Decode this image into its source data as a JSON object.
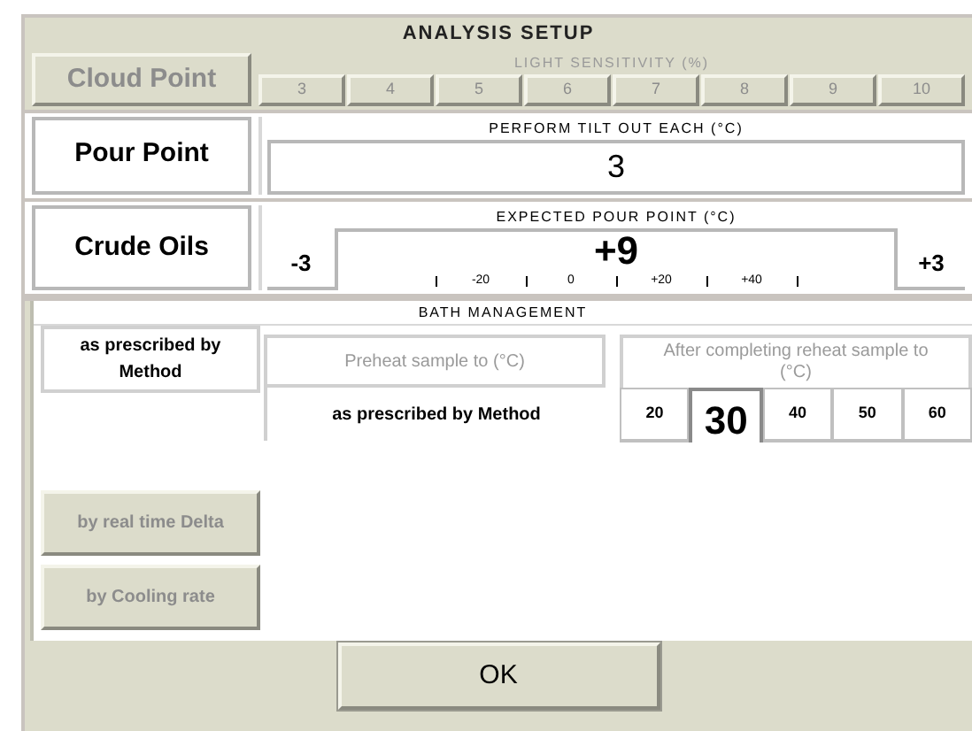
{
  "window": {
    "title": "ANALYSIS SETUP"
  },
  "cloud_point": {
    "label": "Cloud Point",
    "selected": false
  },
  "light_sensitivity": {
    "label": "LIGHT SENSITIVITY (%)",
    "disabled": true,
    "options": [
      {
        "label": "3"
      },
      {
        "label": "4"
      },
      {
        "label": "5"
      },
      {
        "label": "6"
      },
      {
        "label": "7"
      },
      {
        "label": "8"
      },
      {
        "label": "9"
      },
      {
        "label": "10"
      }
    ]
  },
  "pour_point": {
    "label": "Pour Point",
    "selected": true
  },
  "tilt_out": {
    "label": "PERFORM TILT OUT EACH (°C)",
    "value": "3"
  },
  "oil_type": {
    "label": "Crude Oils",
    "selected": true
  },
  "expected_pour_point": {
    "label": "EXPECTED POUR POINT (°C)",
    "decrement": "-3",
    "value": "+9",
    "increment": "+3",
    "scale_labels": [
      "-20",
      "0",
      "+20",
      "+40"
    ]
  },
  "bath_management": {
    "title": "BATH MANAGEMENT",
    "methods": [
      {
        "label": "as prescribed by Method",
        "selected": true
      },
      {
        "label": "by real time Delta",
        "selected": false
      },
      {
        "label": "by Cooling rate",
        "selected": false
      }
    ],
    "preheat": {
      "label": "Preheat sample to (°C)",
      "disabled": true,
      "value": "as prescribed by Method"
    },
    "reheat": {
      "label": "After completing reheat sample to (°C)",
      "disabled": true,
      "options": [
        {
          "label": "20",
          "selected": false
        },
        {
          "label": "30",
          "selected": true
        },
        {
          "label": "40",
          "selected": false
        },
        {
          "label": "50",
          "selected": false
        },
        {
          "label": "60",
          "selected": false
        }
      ]
    }
  },
  "buttons": [
    {
      "label": "OK"
    }
  ]
}
